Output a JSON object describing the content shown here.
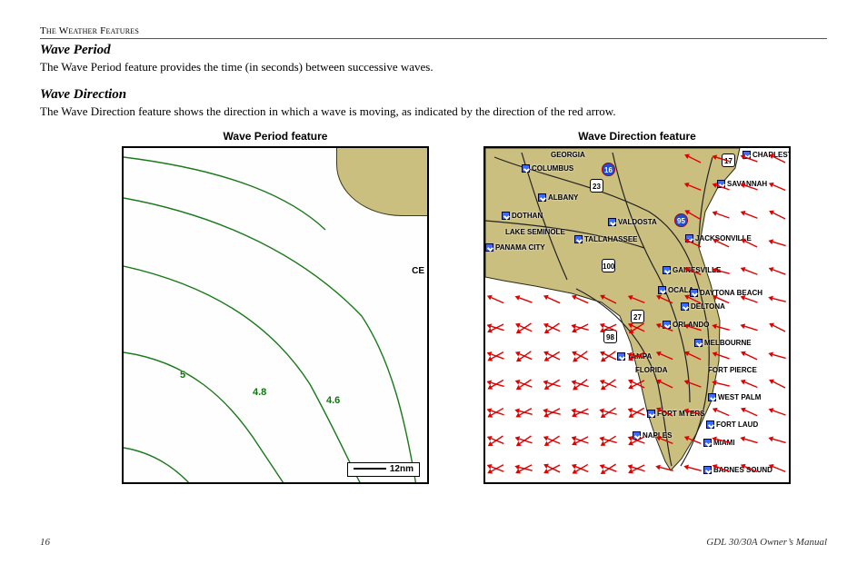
{
  "header": {
    "section": "The Weather Features"
  },
  "wave_period": {
    "heading": "Wave Period",
    "body": "The Wave Period feature provides the time (in seconds) between successive waves."
  },
  "wave_direction": {
    "heading": "Wave Direction",
    "body": "The Wave Direction feature shows the direction in which a wave is moving, as indicated by the direction of the red arrow."
  },
  "figures": {
    "period_caption": "Wave Period feature",
    "direction_caption": "Wave Direction feature",
    "period_labels": {
      "a": "5",
      "b": "4.8",
      "c": "4.6"
    },
    "period_edge_label": "CE",
    "scale": "12nm"
  },
  "map_cities": [
    "GEORGIA",
    "COLUMBUS",
    "ALBANY",
    "DOTHAN",
    "LAKE SEMINOLE",
    "PANAMA CITY",
    "VALDOSTA",
    "TALLAHASSEE",
    "JACKSONVILLE",
    "GAINESVILLE",
    "OCALA",
    "DAYTONA BEACH",
    "DELTONA",
    "ORLANDO",
    "MELBOURNE",
    "TAMPA",
    "FLORIDA",
    "FORT PIERCE",
    "WEST PALM",
    "FORT MYERS",
    "FORT LAUD",
    "NAPLES",
    "MIAMI",
    "BARNES SOUND",
    "SAVANNAH",
    "CHARLEST"
  ],
  "footer": {
    "page": "16",
    "manual": "GDL 30/30A Owner’s Manual"
  }
}
